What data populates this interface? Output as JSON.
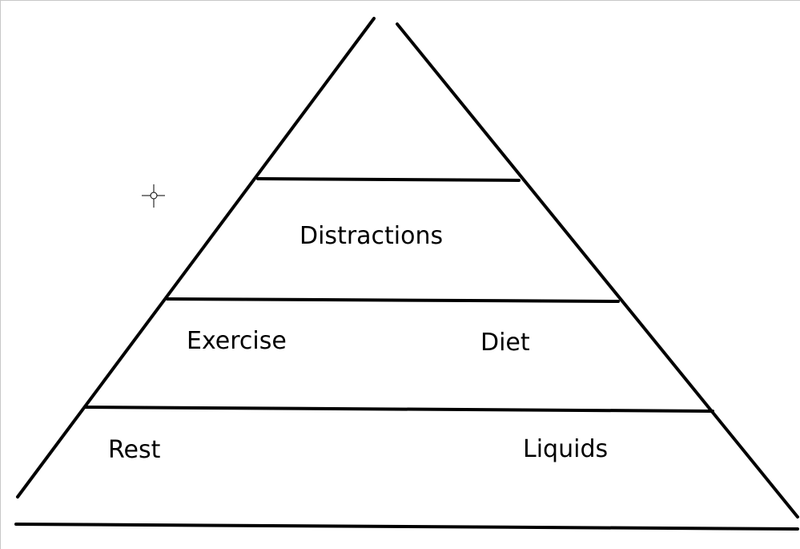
{
  "diagram": {
    "type": "pyramid",
    "levels": [
      {
        "labels": []
      },
      {
        "labels": [
          "Distractions"
        ]
      },
      {
        "labels": [
          "Exercise",
          "Diet"
        ]
      },
      {
        "labels": [
          "Rest",
          "Liquids"
        ]
      }
    ]
  },
  "colors": {
    "stroke": "#000000",
    "background": "#ffffff",
    "cursor": "#000000"
  },
  "icons": {
    "cursor": "crosshair-cursor-icon"
  }
}
